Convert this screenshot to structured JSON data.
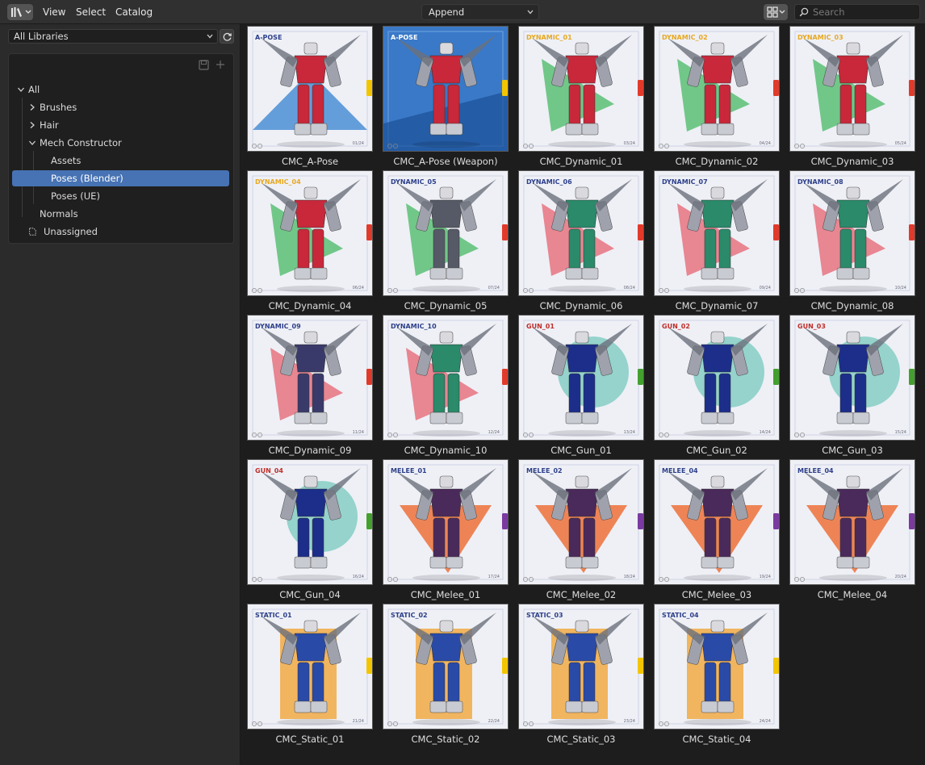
{
  "header": {
    "menu": [
      "View",
      "Select",
      "Catalog"
    ],
    "import_method": "Append",
    "search_placeholder": "Search"
  },
  "sidebar": {
    "library": "All Libraries",
    "tree": [
      {
        "label": "All",
        "level": 0,
        "expanded": true
      },
      {
        "label": "Brushes",
        "level": 1,
        "expanded": false
      },
      {
        "label": "Hair",
        "level": 1,
        "expanded": false
      },
      {
        "label": "Mech Constructor",
        "level": 1,
        "expanded": true
      },
      {
        "label": "Assets",
        "level": 2
      },
      {
        "label": "Poses (Blender)",
        "level": 2,
        "selected": true
      },
      {
        "label": "Poses (UE)",
        "level": 2
      },
      {
        "label": "Normals",
        "level": 1
      },
      {
        "label": "Unassigned",
        "level": 0
      }
    ]
  },
  "assets": [
    {
      "name": "CMC_A-Pose",
      "badge": "A-POSE",
      "page": "01/24",
      "tab": "#f2c500",
      "shape": "#2f7fd0",
      "accent": "#c8283a"
    },
    {
      "name": "CMC_A-Pose (Weapon)",
      "badge": "A-POSE",
      "page": "",
      "tab": "#f2c500",
      "shape": "#1d5fae",
      "accent": "#c8283a"
    },
    {
      "name": "CMC_Dynamic_01",
      "badge": "DYNAMIC_01",
      "page": "03/24",
      "tab": "#e23a2a",
      "shape": "#2bb04a",
      "accent": "#c8283a"
    },
    {
      "name": "CMC_Dynamic_02",
      "badge": "DYNAMIC_02",
      "page": "04/24",
      "tab": "#e23a2a",
      "shape": "#2bb04a",
      "accent": "#c8283a"
    },
    {
      "name": "CMC_Dynamic_03",
      "badge": "DYNAMIC_03",
      "page": "05/24",
      "tab": "#e23a2a",
      "shape": "#2bb04a",
      "accent": "#c8283a"
    },
    {
      "name": "CMC_Dynamic_04",
      "badge": "DYNAMIC_04",
      "page": "06/24",
      "tab": "#e23a2a",
      "shape": "#2bb04a",
      "accent": "#c8283a"
    },
    {
      "name": "CMC_Dynamic_05",
      "badge": "DYNAMIC_05",
      "page": "07/24",
      "tab": "#e23a2a",
      "shape": "#2bb04a",
      "accent": "#555a66"
    },
    {
      "name": "CMC_Dynamic_06",
      "badge": "DYNAMIC_06",
      "page": "08/24",
      "tab": "#e23a2a",
      "shape": "#e4495a",
      "accent": "#2a8a6a"
    },
    {
      "name": "CMC_Dynamic_07",
      "badge": "DYNAMIC_07",
      "page": "09/24",
      "tab": "#e23a2a",
      "shape": "#e4495a",
      "accent": "#2a8a6a"
    },
    {
      "name": "CMC_Dynamic_08",
      "badge": "DYNAMIC_08",
      "page": "10/24",
      "tab": "#e23a2a",
      "shape": "#e4495a",
      "accent": "#2a8a6a"
    },
    {
      "name": "CMC_Dynamic_09",
      "badge": "DYNAMIC_09",
      "page": "11/24",
      "tab": "#e23a2a",
      "shape": "#e4495a",
      "accent": "#3a3a6a"
    },
    {
      "name": "CMC_Dynamic_10",
      "badge": "DYNAMIC_10",
      "page": "12/24",
      "tab": "#e23a2a",
      "shape": "#e4495a",
      "accent": "#2a8a6a"
    },
    {
      "name": "CMC_Gun_01",
      "badge": "GUN_01",
      "page": "13/24",
      "tab": "#44a02e",
      "shape": "#2fb39a",
      "accent": "#1c2e8a"
    },
    {
      "name": "CMC_Gun_02",
      "badge": "GUN_02",
      "page": "14/24",
      "tab": "#44a02e",
      "shape": "#2fb39a",
      "accent": "#1c2e8a"
    },
    {
      "name": "CMC_Gun_03",
      "badge": "GUN_03",
      "page": "15/24",
      "tab": "#44a02e",
      "shape": "#2fb39a",
      "accent": "#1c2e8a"
    },
    {
      "name": "CMC_Gun_04",
      "badge": "GUN_04",
      "page": "16/24",
      "tab": "#44a02e",
      "shape": "#2fb39a",
      "accent": "#1c2e8a"
    },
    {
      "name": "CMC_Melee_01",
      "badge": "MELEE_01",
      "page": "17/24",
      "tab": "#7a3aa0",
      "shape": "#ef5a1a",
      "accent": "#4a2a5a"
    },
    {
      "name": "CMC_Melee_02",
      "badge": "MELEE_02",
      "page": "18/24",
      "tab": "#7a3aa0",
      "shape": "#ef5a1a",
      "accent": "#4a2a5a"
    },
    {
      "name": "CMC_Melee_03",
      "badge": "MELEE_04",
      "page": "19/24",
      "tab": "#7a3aa0",
      "shape": "#ef5a1a",
      "accent": "#4a2a5a"
    },
    {
      "name": "CMC_Melee_04",
      "badge": "MELEE_04",
      "page": "20/24",
      "tab": "#7a3aa0",
      "shape": "#ef5a1a",
      "accent": "#4a2a5a"
    },
    {
      "name": "CMC_Static_01",
      "badge": "STATIC_01",
      "page": "21/24",
      "tab": "#f2c500",
      "shape": "#f39a1a",
      "accent": "#2a4aa8"
    },
    {
      "name": "CMC_Static_02",
      "badge": "STATIC_02",
      "page": "22/24",
      "tab": "#f2c500",
      "shape": "#f39a1a",
      "accent": "#2a4aa8"
    },
    {
      "name": "CMC_Static_03",
      "badge": "STATIC_03",
      "page": "23/24",
      "tab": "#f2c500",
      "shape": "#f39a1a",
      "accent": "#2a4aa8"
    },
    {
      "name": "CMC_Static_04",
      "badge": "STATIC_04",
      "page": "24/24",
      "tab": "#f2c500",
      "shape": "#f39a1a",
      "accent": "#2a4aa8"
    }
  ]
}
